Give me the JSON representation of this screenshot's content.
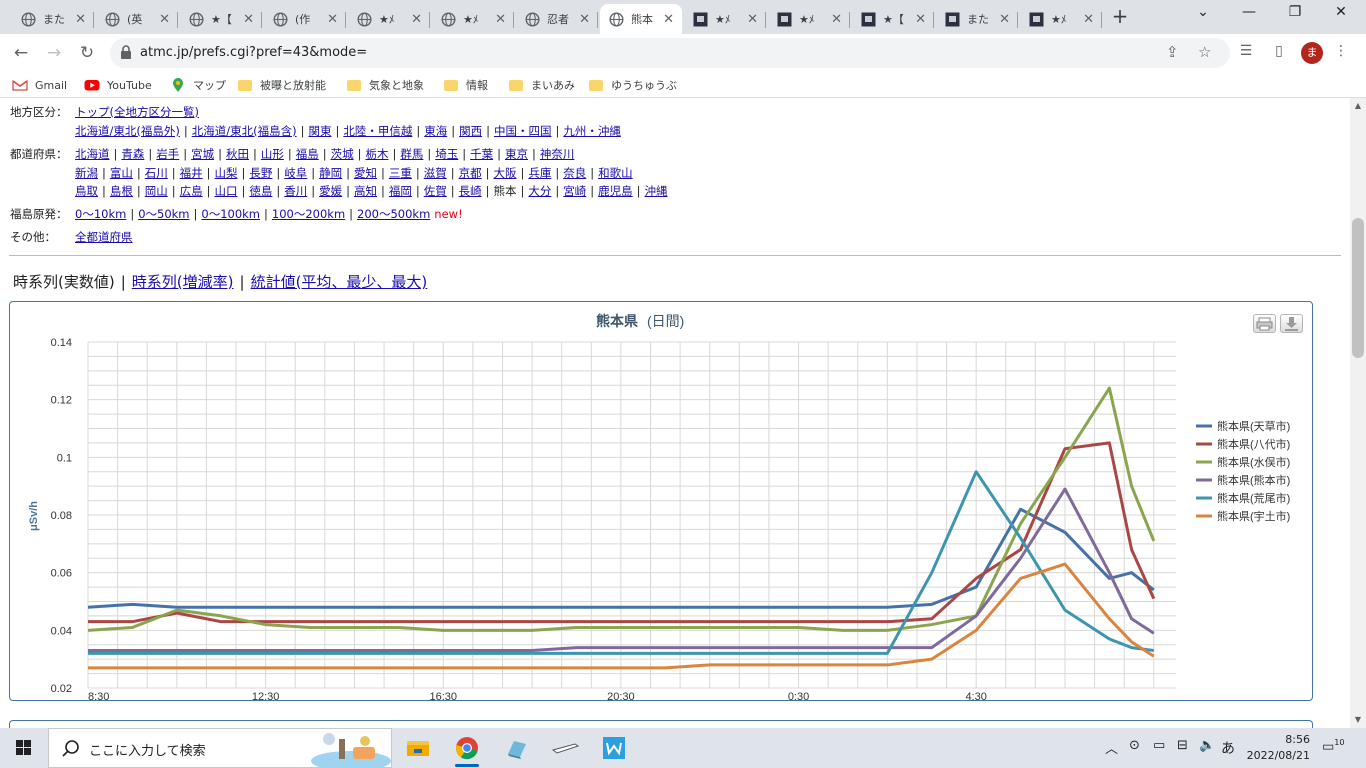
{
  "browser": {
    "tabs": [
      {
        "title": "また",
        "icon": "globe-icon"
      },
      {
        "title": "(英",
        "icon": "globe-icon"
      },
      {
        "title": "★【",
        "icon": "globe-icon"
      },
      {
        "title": "(作",
        "icon": "globe-icon"
      },
      {
        "title": "★ﾒ",
        "icon": "globe-icon"
      },
      {
        "title": "★ﾒ",
        "icon": "globe-icon"
      },
      {
        "title": "忍者",
        "icon": "globe-icon"
      },
      {
        "title": "熊本",
        "icon": "globe-icon",
        "active": true
      },
      {
        "title": "★ﾒ",
        "icon": "site-icon"
      },
      {
        "title": "★ﾒ",
        "icon": "site-icon"
      },
      {
        "title": "★【",
        "icon": "site-icon"
      },
      {
        "title": "また",
        "icon": "site-icon"
      },
      {
        "title": "★ﾒ",
        "icon": "site-icon"
      }
    ],
    "url": "atmc.jp/prefs.cgi?pref=43&mode=",
    "avatar_letter": "ま",
    "bookmarks": [
      {
        "label": "Gmail",
        "icon": "gmail-icon"
      },
      {
        "label": "YouTube",
        "icon": "youtube-icon"
      },
      {
        "label": "マップ",
        "icon": "maps-icon"
      },
      {
        "label": "被曝と放射能",
        "icon": "folder-icon"
      },
      {
        "label": "気象と地象",
        "icon": "folder-icon"
      },
      {
        "label": "情報",
        "icon": "folder-icon"
      },
      {
        "label": "まいあみ",
        "icon": "folder-icon"
      },
      {
        "label": "ゆうちゅうぶ",
        "icon": "folder-icon"
      }
    ]
  },
  "nav": {
    "region_label": "地方区分：",
    "region_top": "トップ(全地方区分一覧)",
    "regions": [
      "北海道/東北(福島外)",
      "北海道/東北(福島含)",
      "関東",
      "北陸・甲信越",
      "東海",
      "関西",
      "中国・四国",
      "九州・沖縄"
    ],
    "pref_label": "都道府県：",
    "prefs_row1": [
      "北海道",
      "青森",
      "岩手",
      "宮城",
      "秋田",
      "山形",
      "福島",
      "茨城",
      "栃木",
      "群馬",
      "埼玉",
      "千葉",
      "東京",
      "神奈川"
    ],
    "prefs_row2": [
      "新潟",
      "富山",
      "石川",
      "福井",
      "山梨",
      "長野",
      "岐阜",
      "静岡",
      "愛知",
      "三重",
      "滋賀",
      "京都",
      "大阪",
      "兵庫",
      "奈良",
      "和歌山"
    ],
    "prefs_row3": [
      "鳥取",
      "島根",
      "岡山",
      "広島",
      "山口",
      "徳島",
      "香川",
      "愛媛",
      "高知",
      "福岡",
      "佐賀",
      "長崎",
      "熊本",
      "大分",
      "宮崎",
      "鹿児島",
      "沖縄"
    ],
    "prefs_row3_current": "熊本",
    "fukushima_label": "福島原発：",
    "fukushima_links": [
      "0〜10km",
      "0〜50km",
      "0〜100km",
      "100〜200km",
      "200〜500km"
    ],
    "new_badge": "new!",
    "other_label": "その他：",
    "other_link": "全都道府県"
  },
  "view_tabs": {
    "current": "時系列(実数値)",
    "links": [
      "時系列(増減率)",
      "統計値(平均、最少、最大)"
    ]
  },
  "chart_data": {
    "type": "line",
    "title": "熊本県",
    "subtitle": "(日間)",
    "ylabel": "μSv/h",
    "ylim": [
      0.02,
      0.14
    ],
    "yticks": [
      "0.14",
      "0.12",
      "0.1",
      "0.08",
      "0.06",
      "0.04",
      "0.02"
    ],
    "xticks": [
      "8:30",
      "12:30",
      "16:30",
      "20:30",
      "0:30",
      "4:30"
    ],
    "x_hours": [
      0,
      1,
      2,
      3,
      4,
      5,
      6,
      7,
      8,
      9,
      10,
      11,
      12,
      13,
      14,
      15,
      16,
      17,
      18,
      19,
      20,
      21,
      22,
      23,
      23.5,
      24
    ],
    "legend_position": "right",
    "grid": true,
    "series": [
      {
        "name": "熊本県(天草市)",
        "color": "#4572a7",
        "values": [
          0.048,
          0.049,
          0.048,
          0.048,
          0.048,
          0.048,
          0.048,
          0.048,
          0.048,
          0.048,
          0.048,
          0.048,
          0.048,
          0.048,
          0.048,
          0.048,
          0.048,
          0.048,
          0.048,
          0.049,
          0.055,
          0.082,
          0.074,
          0.058,
          0.06,
          0.054
        ]
      },
      {
        "name": "熊本県(八代市)",
        "color": "#aa4643",
        "values": [
          0.043,
          0.043,
          0.046,
          0.043,
          0.043,
          0.043,
          0.043,
          0.043,
          0.043,
          0.043,
          0.043,
          0.043,
          0.043,
          0.043,
          0.043,
          0.043,
          0.043,
          0.043,
          0.043,
          0.044,
          0.058,
          0.068,
          0.103,
          0.105,
          0.068,
          0.051
        ]
      },
      {
        "name": "熊本県(水俣市)",
        "color": "#89a54e",
        "values": [
          0.04,
          0.041,
          0.047,
          0.045,
          0.042,
          0.041,
          0.041,
          0.041,
          0.04,
          0.04,
          0.04,
          0.041,
          0.041,
          0.041,
          0.041,
          0.041,
          0.041,
          0.04,
          0.04,
          0.042,
          0.045,
          0.077,
          0.1,
          0.124,
          0.09,
          0.071
        ]
      },
      {
        "name": "熊本県(熊本市)",
        "color": "#80699b",
        "values": [
          0.033,
          0.033,
          0.033,
          0.033,
          0.033,
          0.033,
          0.033,
          0.033,
          0.033,
          0.033,
          0.033,
          0.034,
          0.034,
          0.034,
          0.034,
          0.034,
          0.034,
          0.034,
          0.034,
          0.034,
          0.045,
          0.065,
          0.089,
          0.06,
          0.044,
          0.039
        ]
      },
      {
        "name": "熊本県(荒尾市)",
        "color": "#3d96ae",
        "values": [
          0.032,
          0.032,
          0.032,
          0.032,
          0.032,
          0.032,
          0.032,
          0.032,
          0.032,
          0.032,
          0.032,
          0.032,
          0.032,
          0.032,
          0.032,
          0.032,
          0.032,
          0.032,
          0.032,
          0.06,
          0.095,
          0.072,
          0.047,
          0.037,
          0.034,
          0.033
        ]
      },
      {
        "name": "熊本県(宇土市)",
        "color": "#db843d",
        "values": [
          0.027,
          0.027,
          0.027,
          0.027,
          0.027,
          0.027,
          0.027,
          0.027,
          0.027,
          0.027,
          0.027,
          0.027,
          0.027,
          0.027,
          0.028,
          0.028,
          0.028,
          0.028,
          0.028,
          0.03,
          0.04,
          0.058,
          0.063,
          0.044,
          0.036,
          0.031
        ]
      }
    ]
  },
  "taskbar": {
    "search_placeholder": "ここに入力して検索",
    "ime": "あ",
    "time": "8:56",
    "date": "2022/08/21",
    "notifications": "10"
  }
}
